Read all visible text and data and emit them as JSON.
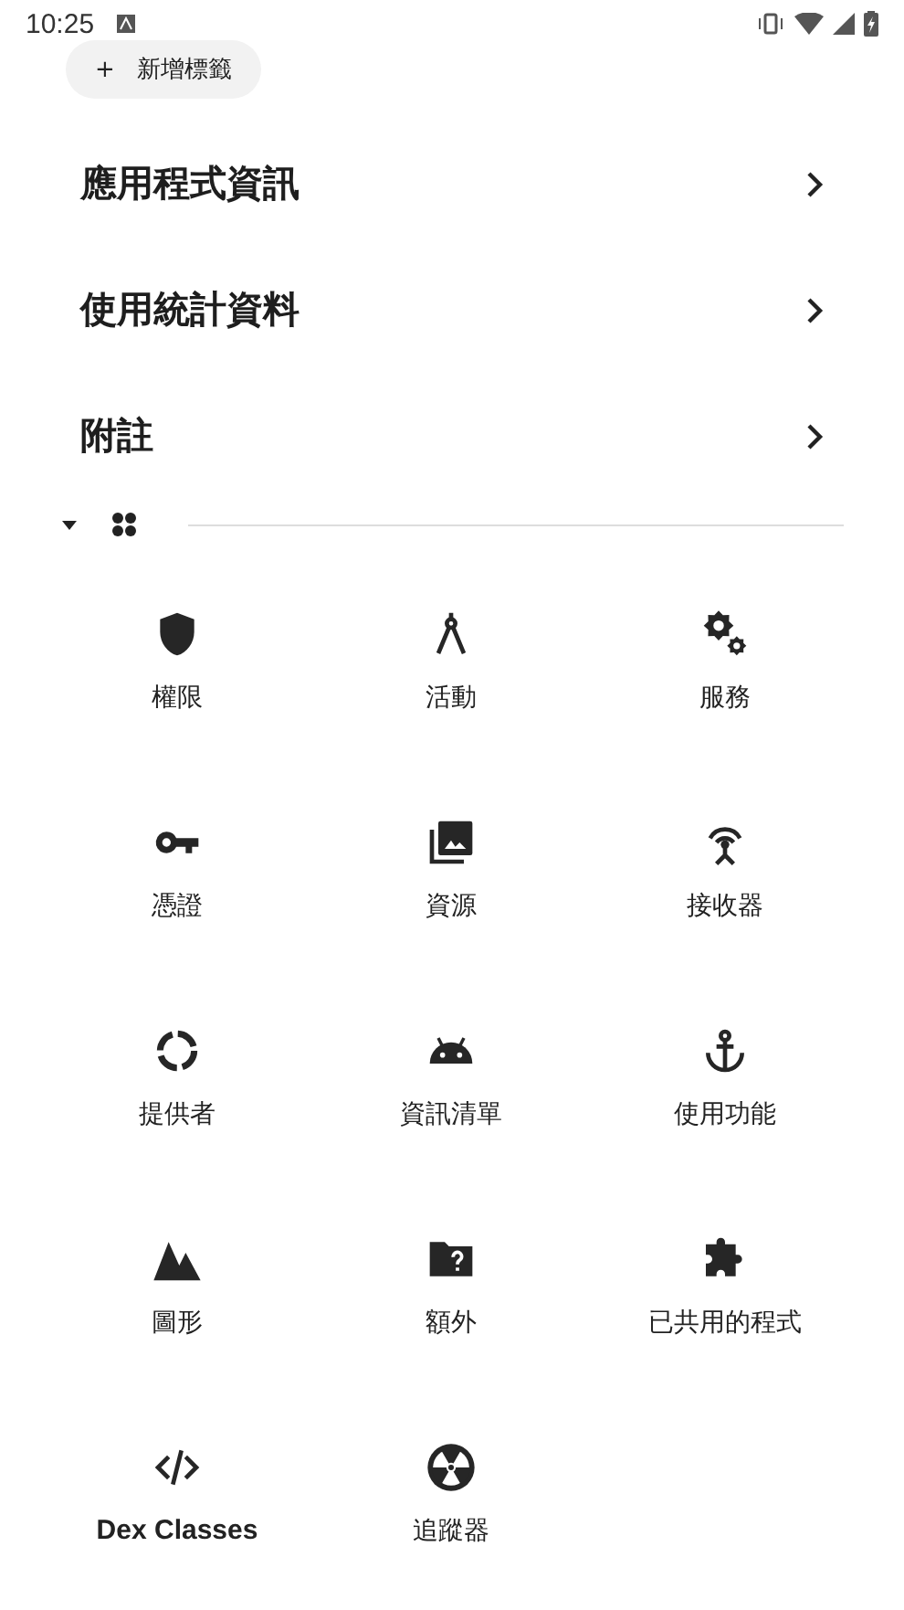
{
  "status_bar": {
    "time": "10:25"
  },
  "chip": {
    "label": "新增標籤",
    "icon": "+"
  },
  "rows": [
    {
      "label": "應用程式資訊"
    },
    {
      "label": "使用統計資料"
    },
    {
      "label": "附註"
    }
  ],
  "section": {
    "expanded": true
  },
  "tiles": [
    {
      "label": "權限",
      "bold": false
    },
    {
      "label": "活動",
      "bold": false
    },
    {
      "label": "服務",
      "bold": false
    },
    {
      "label": "憑證",
      "bold": false
    },
    {
      "label": "資源",
      "bold": false
    },
    {
      "label": "接收器",
      "bold": false
    },
    {
      "label": "提供者",
      "bold": false
    },
    {
      "label": "資訊清單",
      "bold": false
    },
    {
      "label": "使用功能",
      "bold": false
    },
    {
      "label": "圖形",
      "bold": false
    },
    {
      "label": "額外",
      "bold": false
    },
    {
      "label": "已共用的程式",
      "bold": false
    },
    {
      "label": "Dex Classes",
      "bold": true
    },
    {
      "label": "追蹤器",
      "bold": false
    }
  ]
}
